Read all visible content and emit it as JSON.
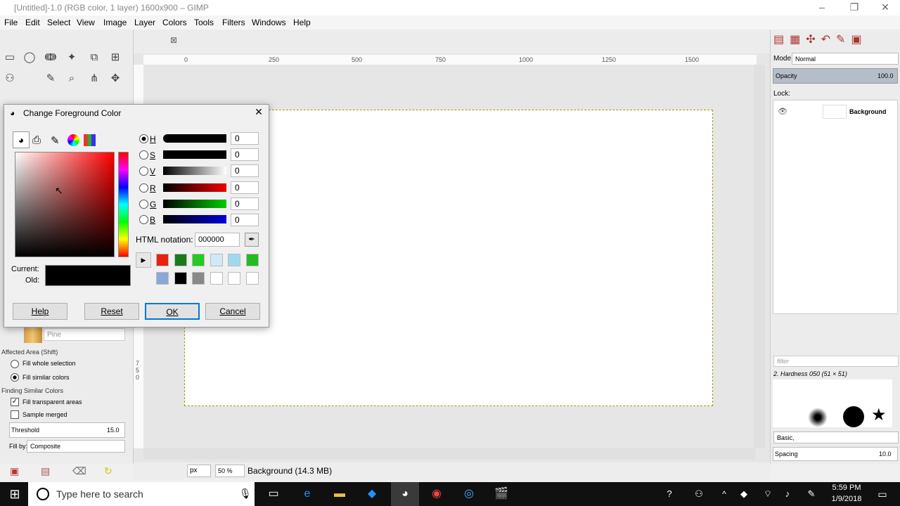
{
  "window": {
    "title": "[Untitled]-1.0 (RGB color, 1 layer) 1600x900 – GIMP",
    "minimize": "–",
    "maximize": "❐",
    "close": "✕"
  },
  "menu": [
    "File",
    "Edit",
    "Select",
    "View",
    "Image",
    "Layer",
    "Colors",
    "Tools",
    "Filters",
    "Windows",
    "Help"
  ],
  "tools": [
    "▭",
    "◯",
    "ↈ",
    "✦",
    "⧉",
    "⊞",
    "⚇",
    "✎",
    "⌕",
    "⋔",
    "✥"
  ],
  "tab_close": "⊠",
  "ruler": {
    "h": [
      "0",
      "250",
      "500",
      "750",
      "1000",
      "1250",
      "1500"
    ],
    "v": [
      "7",
      "5",
      "0"
    ]
  },
  "toolopts": {
    "pattern": "Pine",
    "affected_area": "Affected Area  (Shift)",
    "fill_whole": "Fill whole selection",
    "fill_similar": "Fill similar colors",
    "finding": "Finding Similar Colors",
    "fill_transparent": "Fill transparent areas",
    "sample_merged": "Sample merged",
    "threshold_label": "Threshold",
    "threshold_value": "15.0",
    "fillby_label": "Fill by:",
    "fillby_value": "Composite"
  },
  "dialog": {
    "title": "Change Foreground Color",
    "close": "✕",
    "channels": [
      {
        "key": "H",
        "value": "0",
        "color": "#000"
      },
      {
        "key": "S",
        "value": "0",
        "color": "#000"
      },
      {
        "key": "V",
        "value": "0",
        "color": "#888"
      },
      {
        "key": "R",
        "value": "0",
        "color": "#d00"
      },
      {
        "key": "G",
        "value": "0",
        "color": "#0b0"
      },
      {
        "key": "B",
        "value": "0",
        "color": "#00d"
      }
    ],
    "html_label": "HTML notation:",
    "html_value": "000000",
    "current_label": "Current:",
    "old_label": "Old:",
    "history": [
      "#e8220e",
      "#1a7a1a",
      "#22cc22",
      "#d0e8f8",
      "#a0d8f0",
      "#22bb22",
      "#8aa8d8",
      "#000000",
      "#888888",
      "#ffffff",
      "#ffffff",
      "#ffffff"
    ],
    "help": "Help",
    "reset": "Reset",
    "ok": "OK",
    "cancel": "Cancel"
  },
  "layers": {
    "mode_label": "Mode:",
    "mode_value": "Normal",
    "opacity_label": "Opacity",
    "opacity_value": "100.0",
    "lock_label": "Lock:",
    "layer_name": "Background"
  },
  "brushes": {
    "filter_placeholder": "filter",
    "brush_name": "2. Hardness 050 (51 × 51)",
    "preset": "Basic,",
    "spacing_label": "Spacing",
    "spacing_value": "10.0"
  },
  "status": {
    "unit": "px",
    "zoom": "50 %",
    "info": "Background (14.3 MB)"
  },
  "taskbar": {
    "search": "Type here to search",
    "time": "5:59 PM",
    "date": "1/9/2018"
  }
}
